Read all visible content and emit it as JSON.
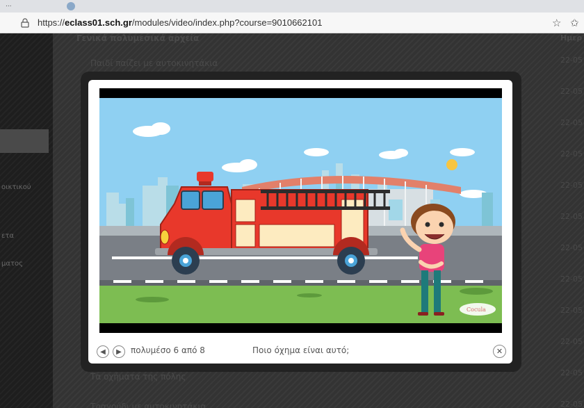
{
  "browser": {
    "tab_title": "...",
    "url_prefix": "https://",
    "url_host": "eclass01.sch.gr",
    "url_path": "/modules/video/index.php?course=9010662101"
  },
  "background": {
    "section_heading": "Γενικά πολυμεσικά αρχεία",
    "date_column": "Ημερ",
    "rows": [
      {
        "title": "Παιδί παίζει με αυτοκινητάκια",
        "date": "22-05"
      },
      {
        "title": "",
        "date": "22-05"
      },
      {
        "title": "",
        "date": "22-05"
      },
      {
        "title": "",
        "date": "22-05"
      },
      {
        "title": "",
        "date": "22-05"
      },
      {
        "title": "",
        "date": "22-05"
      },
      {
        "title": "",
        "date": "22-05"
      },
      {
        "title": "",
        "date": "22-05"
      },
      {
        "title": "",
        "date": "22-05"
      },
      {
        "title": "",
        "date": "22-05"
      },
      {
        "title": "Τα οχήματα της πόλης",
        "date": "22-05"
      },
      {
        "title": "Τραγούδι με αυτοκινητάκια",
        "date": "22-05"
      }
    ],
    "sidebar_items": [
      "οικτικού",
      "ετα",
      "ματος"
    ]
  },
  "lightbox": {
    "counter": "πολυμέσο 6 από 8",
    "caption": "Ποιο όχημα είναι αυτό;",
    "watermark": "Cocula"
  },
  "colors": {
    "sky": "#8fd0f2",
    "truck_red": "#e8382b",
    "grass": "#7dbd52",
    "road": "#7a7f86"
  }
}
